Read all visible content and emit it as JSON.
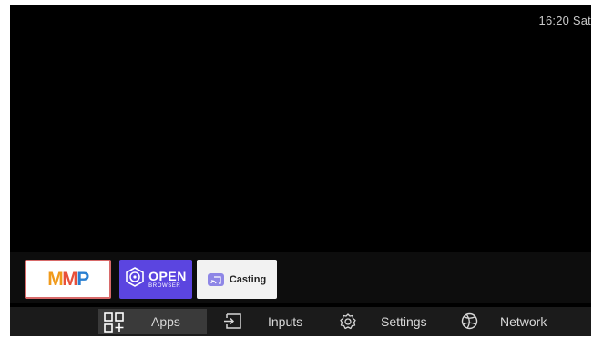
{
  "status": {
    "clock": "16:20 Sat"
  },
  "apps": [
    {
      "name": "MMP",
      "logo_text": "MMP"
    },
    {
      "name": "Open Browser",
      "logo_big": "OPEN",
      "logo_small": "BROWSER"
    },
    {
      "name": "Casting",
      "label": "Casting"
    }
  ],
  "nav": {
    "apps_label": "Apps",
    "inputs_label": "Inputs",
    "settings_label": "Settings",
    "network_label": "Network"
  },
  "icons": {
    "apps": "apps-grid-icon",
    "inputs": "input-source-icon",
    "settings": "gear-icon",
    "network": "network-globe-icon",
    "open_browser": "browser-logo-icon",
    "casting": "cast-icon"
  },
  "colors": {
    "screen_bg": "#000000",
    "mmp_border": "#d86a6a",
    "open_browser_bg": "#5b45e0",
    "casting_bg": "#f2f2f2",
    "nav_bg": "#1b1b1b",
    "nav_selected": "#3a3a3a"
  }
}
